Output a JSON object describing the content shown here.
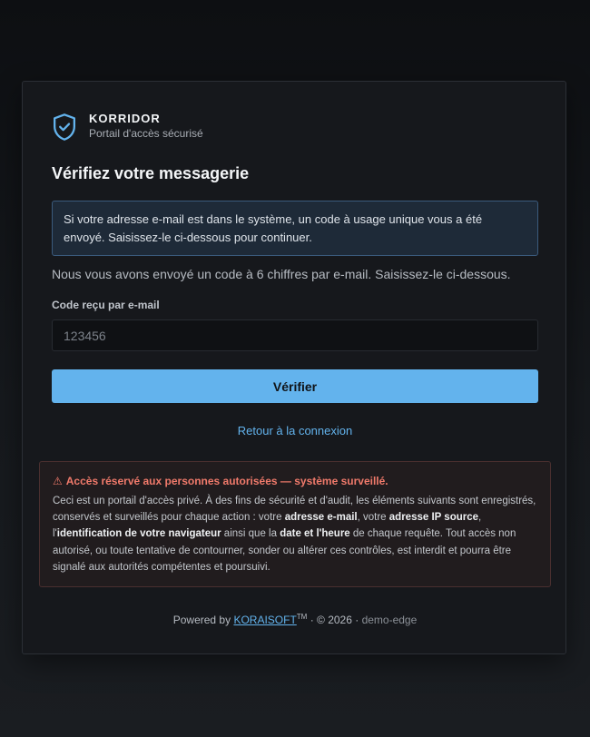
{
  "brand": {
    "name": "KORRIDOR",
    "subtitle": "Portail d'accès sécurisé"
  },
  "page": {
    "title": "Vérifiez votre messagerie"
  },
  "info_box": {
    "text": "Si votre adresse e-mail est dans le système, un code à usage unique vous a été envoyé. Saisissez-le ci-dessous pour continuer."
  },
  "lead_text": "Nous vous avons envoyé un code à 6 chiffres par e-mail. Saisissez-le ci-dessous.",
  "form": {
    "code_label": "Code reçu par e-mail",
    "code_placeholder": "123456",
    "code_value": "",
    "verify_label": "Vérifier",
    "back_link": "Retour à la connexion"
  },
  "warning": {
    "icon": "⚠",
    "title": "Accès réservé aux personnes autorisées — système surveillé.",
    "intro": "Ceci est un portail d'accès privé. À des fins de sécurité et d'audit, les éléments suivants sont enregistrés, conservés et surveillés pour chaque action : votre ",
    "email_strong": "adresse e-mail",
    "sep1": ", votre ",
    "ip_strong": "adresse IP source",
    "sep2": ", l'",
    "browser_strong": "identification de votre navigateur",
    "sep3": " ainsi que la ",
    "datetime_strong": "date et l'heure",
    "outro": " de chaque requête. Tout accès non autorisé, ou toute tentative de contourner, sonder ou altérer ces contrôles, est interdit et pourra être signalé aux autorités compétentes et poursuivi."
  },
  "footer": {
    "powered_by": "Powered by",
    "vendor": "KORAISOFT",
    "tm": "TM",
    "copyright": "· © 2026 ·",
    "instance": "demo-edge"
  },
  "colors": {
    "accent": "#63b3ed",
    "warning_text": "#f07a6b",
    "card_bg": "#16181c"
  },
  "icons": {
    "brand": "shield-check-icon",
    "warning": "warning-triangle-icon"
  }
}
